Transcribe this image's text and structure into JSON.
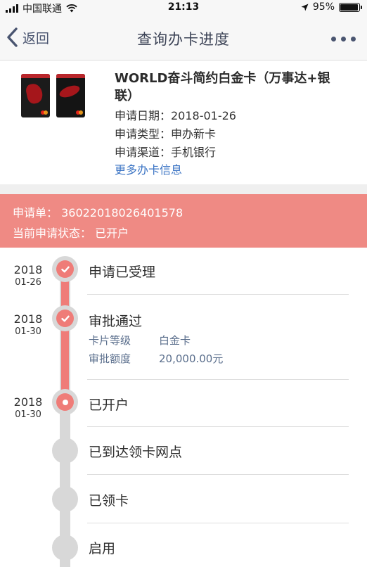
{
  "status_bar": {
    "carrier": "中国联通",
    "time": "21:13",
    "battery": "95%",
    "battery_level": 0.95
  },
  "nav": {
    "back_label": "返回",
    "title": "查询办卡进度",
    "more_icon": "more-dots-icon"
  },
  "card": {
    "name": "WORLD奋斗简约白金卡（万事达+银联）",
    "apply_date": "申请日期：2018-01-26",
    "apply_type": "申请类型：申办新卡",
    "apply_channel": "申请渠道：手机银行",
    "more_info_link": "更多办卡信息"
  },
  "application": {
    "number_line": "申请单：  36022018026401578",
    "status_line": "当前申请状态：  已开户"
  },
  "timeline": {
    "steps": [
      {
        "year": "2018",
        "date": "01-26",
        "label": "申请已受理",
        "state": "done"
      },
      {
        "year": "2018",
        "date": "01-30",
        "label": "审批通过",
        "state": "done",
        "details": [
          {
            "key": "卡片等级",
            "value": "白金卡"
          },
          {
            "key": "审批额度",
            "value": "20,000.00元"
          }
        ]
      },
      {
        "year": "2018",
        "date": "01-30",
        "label": "已开户",
        "state": "current"
      },
      {
        "year": "",
        "date": "",
        "label": "已到达领卡网点",
        "state": "pending"
      },
      {
        "year": "",
        "date": "",
        "label": "已领卡",
        "state": "pending"
      },
      {
        "year": "",
        "date": "",
        "label": "启用",
        "state": "pending"
      }
    ]
  },
  "colors": {
    "accent": "#ef7c78",
    "banner": "#ef8a84",
    "link": "#3b74c4",
    "track": "#d8d8d8"
  }
}
